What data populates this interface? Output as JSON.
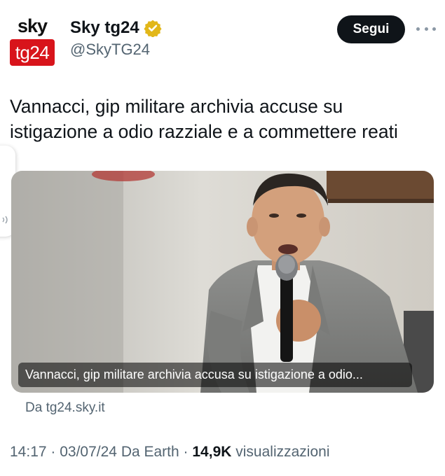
{
  "account": {
    "avatar_top": "sky",
    "avatar_bottom": "tg24",
    "display_name": "Sky tg24",
    "handle": "@SkyTG24",
    "verified_icon": "gold-verified-badge-icon",
    "brand_color": "#d8141b",
    "verified_color": "#e2b719"
  },
  "actions": {
    "follow_label": "Segui",
    "more_icon": "more-horizontal-icon"
  },
  "tweet": {
    "text": "Vannacci, gip militare archivia accuse su istigazione a odio razziale e a commettere reati"
  },
  "card": {
    "image_subject": "man-speaking-into-microphone-photo",
    "caption": "Vannacci, gip militare archivia accusa su istigazione a odio...",
    "source": "Da tg24.sky.it"
  },
  "meta": {
    "time": "14:17",
    "sep1": " · ",
    "date": "03/07/24",
    "client": " Da Earth",
    "sep2": " · ",
    "views_count": "14,9K",
    "views_label": " visualizzazioni"
  }
}
